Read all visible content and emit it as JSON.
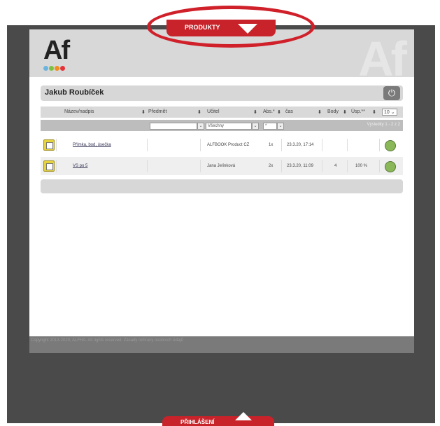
{
  "nav": {
    "top_tab_label": "PRODUKTY",
    "bottom_tab_label": "PŘIHLÁŠENÍ"
  },
  "logo": {
    "text": "Af"
  },
  "user": {
    "name": "Jakub Roubíček"
  },
  "table": {
    "headers": [
      "Název/nadpis",
      "Předmět",
      "Učitel",
      "Abs.*",
      "čas",
      "Body",
      "Úsp.**"
    ],
    "page_size": "10",
    "filters": {
      "subject": "",
      "teacher": "Všechny",
      "abs": "*",
      "extra": ""
    },
    "results_text": "Výsledky 1 - 2 z 2",
    "rows": [
      {
        "title": "Přímka, bod, úsečka",
        "subject": "",
        "teacher": "ALFBOOK Product CZ",
        "abs": "1x",
        "time": "23.3.20, 17:14",
        "points": "",
        "success": ""
      },
      {
        "title": "VS po 5",
        "subject": "",
        "teacher": "Jana Jelínková",
        "abs": "2x",
        "time": "23.3.20, 11:09",
        "points": "4",
        "success": "100 %"
      }
    ]
  },
  "footer": {
    "copyright": "Copyright 2013-2020, ALFHA. All rights reserved. Zásady ochrany osobních údajů"
  },
  "colors": {
    "accent_red": "#c8232a",
    "dark_bg": "#4a4a4a",
    "panel_header": "#d8d8d8"
  }
}
